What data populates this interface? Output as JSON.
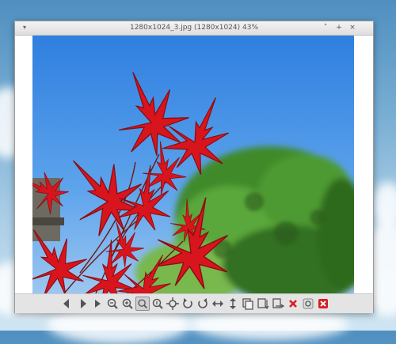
{
  "window": {
    "title": "1280x1024_3.jpg (1280x1024) 43%",
    "menu_glyph": "▾",
    "minimize_glyph": "˄",
    "maximize_glyph": "+",
    "close_glyph": "×"
  },
  "image": {
    "subject": "red Japanese maple leaves against blue sky and green tree"
  },
  "toolbar": {
    "buttons": [
      {
        "name": "previous-icon"
      },
      {
        "name": "next-icon"
      },
      {
        "name": "slideshow-icon"
      },
      {
        "name": "zoom-out-icon"
      },
      {
        "name": "zoom-in-icon"
      },
      {
        "name": "zoom-fit-icon",
        "active": true
      },
      {
        "name": "zoom-original-icon"
      },
      {
        "name": "fullscreen-icon"
      },
      {
        "name": "rotate-left-icon"
      },
      {
        "name": "rotate-right-icon"
      },
      {
        "name": "flip-horizontal-icon"
      },
      {
        "name": "flip-vertical-icon"
      },
      {
        "name": "open-file-icon"
      },
      {
        "name": "save-icon"
      },
      {
        "name": "save-as-icon"
      },
      {
        "name": "delete-icon"
      },
      {
        "name": "preferences-icon"
      },
      {
        "name": "quit-icon"
      }
    ]
  },
  "colors": {
    "accent_red": "#d8151d",
    "delete_red": "#d81e1e",
    "icon_gray": "#555555"
  }
}
